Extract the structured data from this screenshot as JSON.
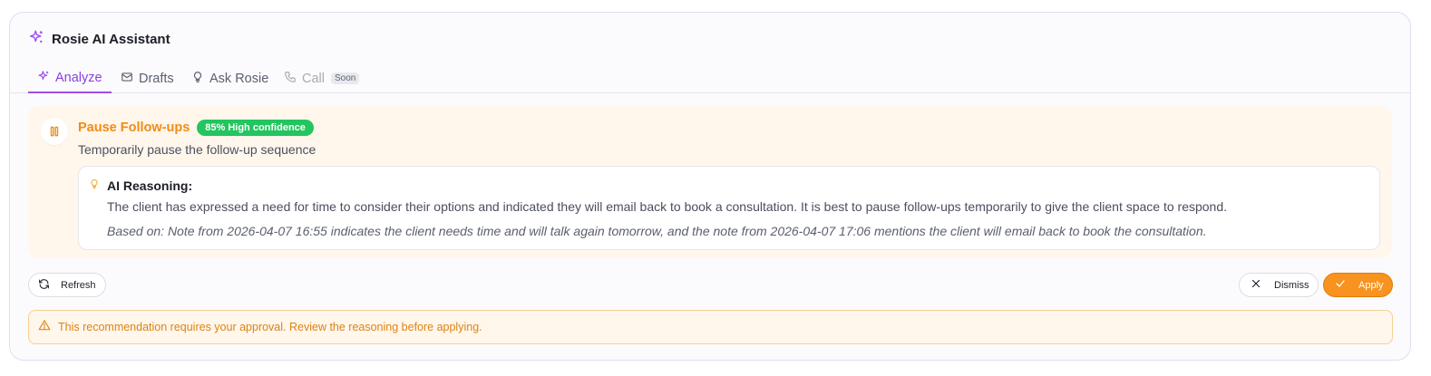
{
  "header": {
    "title": "Rosie AI Assistant",
    "icon": "sparkles-icon"
  },
  "tabs": [
    {
      "label": "Analyze",
      "icon": "sparkles-icon",
      "active": true
    },
    {
      "label": "Drafts",
      "icon": "mail-icon"
    },
    {
      "label": "Ask Rosie",
      "icon": "lightbulb-icon"
    },
    {
      "label": "Call",
      "icon": "phone-icon",
      "disabled": true,
      "badge": "Soon"
    }
  ],
  "recommendation": {
    "icon": "pause-icon",
    "title": "Pause Follow-ups",
    "confidence_badge": "85% High confidence",
    "subtitle": "Temporarily pause the follow-up sequence",
    "reasoning": {
      "heading": "AI Reasoning:",
      "body": "The client has expressed a need for time to consider their options and indicated they will email back to book a consultation. It is best to pause follow-ups temporarily to give the client space to respond.",
      "based_on": "Based on: Note from 2026-04-07 16:55 indicates the client needs time and will talk again tomorrow, and the note from 2026-04-07 17:06 mentions the client will email back to book the consultation."
    }
  },
  "actions": {
    "refresh": "Refresh",
    "dismiss": "Dismiss",
    "apply": "Apply"
  },
  "warning": "This recommendation requires your approval. Review the reasoning before applying.",
  "colors": {
    "accent_purple": "#9d4ded",
    "accent_orange": "#f7931e",
    "confidence_green": "#22c55e",
    "warning_text": "#dd8412"
  }
}
